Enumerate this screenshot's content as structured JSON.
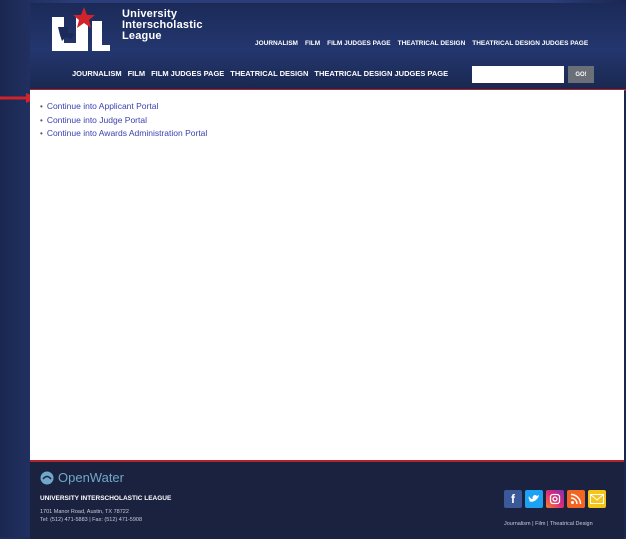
{
  "header": {
    "logo_lines": [
      "University",
      "Interscholastic",
      "League"
    ],
    "top_nav": [
      "JOURNALISM",
      "FILM",
      "FILM JUDGES PAGE",
      "THEATRICAL DESIGN",
      "THEATRICAL DESIGN JUDGES PAGE"
    ],
    "main_nav": [
      "JOURNALISM",
      "FILM",
      "FILM JUDGES PAGE",
      "THEATRICAL DESIGN",
      "THEATRICAL DESIGN JUDGES PAGE"
    ],
    "search": {
      "value": "",
      "placeholder": "",
      "button": "GO!"
    }
  },
  "main": {
    "links": [
      "Continue into Applicant Portal",
      "Continue into Judge Portal",
      "Continue into Awards Administration Portal"
    ]
  },
  "footer": {
    "brand": "OpenWater",
    "org": "UNIVERSITY INTERSCHOLASTIC LEAGUE",
    "address": "1701 Manor Road, Austin, TX 78722",
    "phone": "Tel: (512) 471-5883 | Fax: (512) 471-5908",
    "links": [
      "Journalism",
      "Film",
      "Theatrical Design"
    ],
    "social": [
      "facebook-icon",
      "twitter-icon",
      "instagram-icon",
      "rss-icon",
      "email-icon"
    ]
  },
  "colors": {
    "accent": "#b2232b",
    "navy": "#1b2a58",
    "link": "#3b3fb0"
  }
}
